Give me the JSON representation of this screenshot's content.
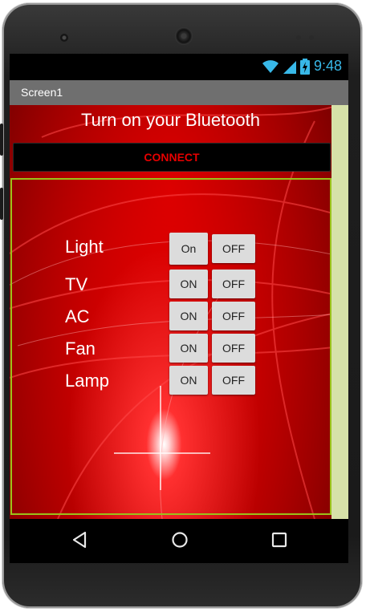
{
  "status_bar": {
    "time": "9:48"
  },
  "app_bar": {
    "title": "Screen1"
  },
  "header": {
    "text": "Turn on your Bluetooth"
  },
  "connect_button": {
    "label": "CONNECT"
  },
  "devices": [
    {
      "name": "Light",
      "on_label": "On",
      "off_label": "OFF"
    },
    {
      "name": "TV",
      "on_label": "ON",
      "off_label": "OFF"
    },
    {
      "name": "AC",
      "on_label": "ON",
      "off_label": "OFF"
    },
    {
      "name": "Fan",
      "on_label": "ON",
      "off_label": "OFF"
    },
    {
      "name": "Lamp",
      "on_label": "ON",
      "off_label": "OFF"
    }
  ],
  "nav_bar": {
    "icons": [
      "back-icon",
      "home-icon",
      "recents-icon"
    ]
  },
  "colors": {
    "accent_cyan": "#38b8e8",
    "connect_text": "#e60000",
    "panel_border": "#9ac21a",
    "side_strip": "#d6e1a8",
    "title_bar": "#6f6f6f",
    "button_bg": "#dcdcdc"
  }
}
